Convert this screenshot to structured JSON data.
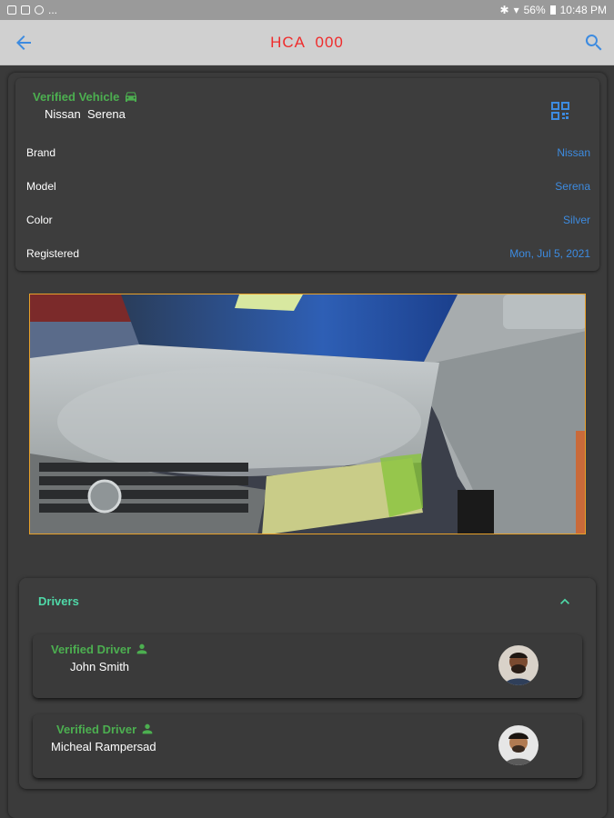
{
  "status_bar": {
    "left_text": "...",
    "battery": "56%",
    "time": "10:48 PM"
  },
  "header": {
    "title": "HCA  000"
  },
  "vehicle": {
    "verified_label": "Verified Vehicle",
    "name": "Nissan  Serena",
    "details": [
      {
        "label": "Brand",
        "value": "Nissan"
      },
      {
        "label": "Model",
        "value": "Serena"
      },
      {
        "label": "Color",
        "value": "Silver"
      },
      {
        "label": "Registered",
        "value": "Mon, Jul 5, 2021"
      }
    ]
  },
  "drivers": {
    "title": "Drivers",
    "items": [
      {
        "verified_label": "Verified Driver",
        "name": "John Smith"
      },
      {
        "verified_label": "Verified Driver",
        "name": "Micheal Rampersad"
      }
    ]
  },
  "colors": {
    "accent_blue": "#3d8be0",
    "verified_green": "#4caf50",
    "title_red": "#ef2b2b",
    "drivers_teal": "#4fd9a8"
  }
}
